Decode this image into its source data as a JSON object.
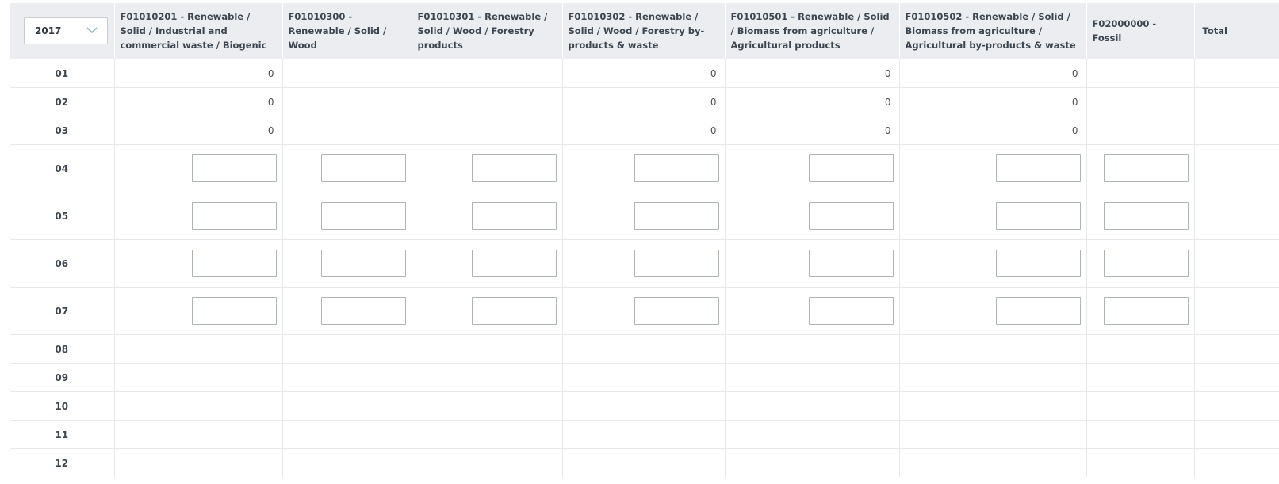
{
  "year_select": {
    "selected": "2017"
  },
  "columns": [
    {
      "label": "F01010201 - Renewable / Solid / Industrial and commercial waste / Biogenic"
    },
    {
      "label": "F01010300 - Renewable / Solid / Wood"
    },
    {
      "label": "F01010301 - Renewable / Solid / Wood / Forestry products"
    },
    {
      "label": "F01010302 - Renewable / Solid / Wood / Forestry by-products & waste"
    },
    {
      "label": "F01010501 - Renewable / Solid / Biomass from agriculture / Agricultural products"
    },
    {
      "label": "F01010502 - Renewable / Solid / Biomass from agriculture / Agricultural by-products & waste"
    },
    {
      "label": "F02000000 - Fossil"
    },
    {
      "label": "Total"
    }
  ],
  "rows": [
    {
      "label": "01",
      "values": [
        "0",
        "",
        "",
        "0",
        "0",
        "0",
        "",
        ""
      ]
    },
    {
      "label": "02",
      "values": [
        "0",
        "",
        "",
        "0",
        "0",
        "0",
        "",
        ""
      ]
    },
    {
      "label": "03",
      "values": [
        "0",
        "",
        "",
        "0",
        "0",
        "0",
        "",
        ""
      ]
    },
    {
      "label": "04",
      "inputs": [
        "",
        "",
        "",
        "",
        "",
        "",
        ""
      ]
    },
    {
      "label": "05",
      "inputs": [
        "",
        "",
        "",
        "",
        "",
        "",
        ""
      ]
    },
    {
      "label": "06",
      "inputs": [
        "",
        "",
        "",
        "",
        "",
        "",
        ""
      ]
    },
    {
      "label": "07",
      "inputs": [
        "",
        "",
        "",
        "",
        "",
        "",
        ""
      ]
    },
    {
      "label": "08"
    },
    {
      "label": "09"
    },
    {
      "label": "10"
    },
    {
      "label": "11"
    },
    {
      "label": "12"
    }
  ]
}
